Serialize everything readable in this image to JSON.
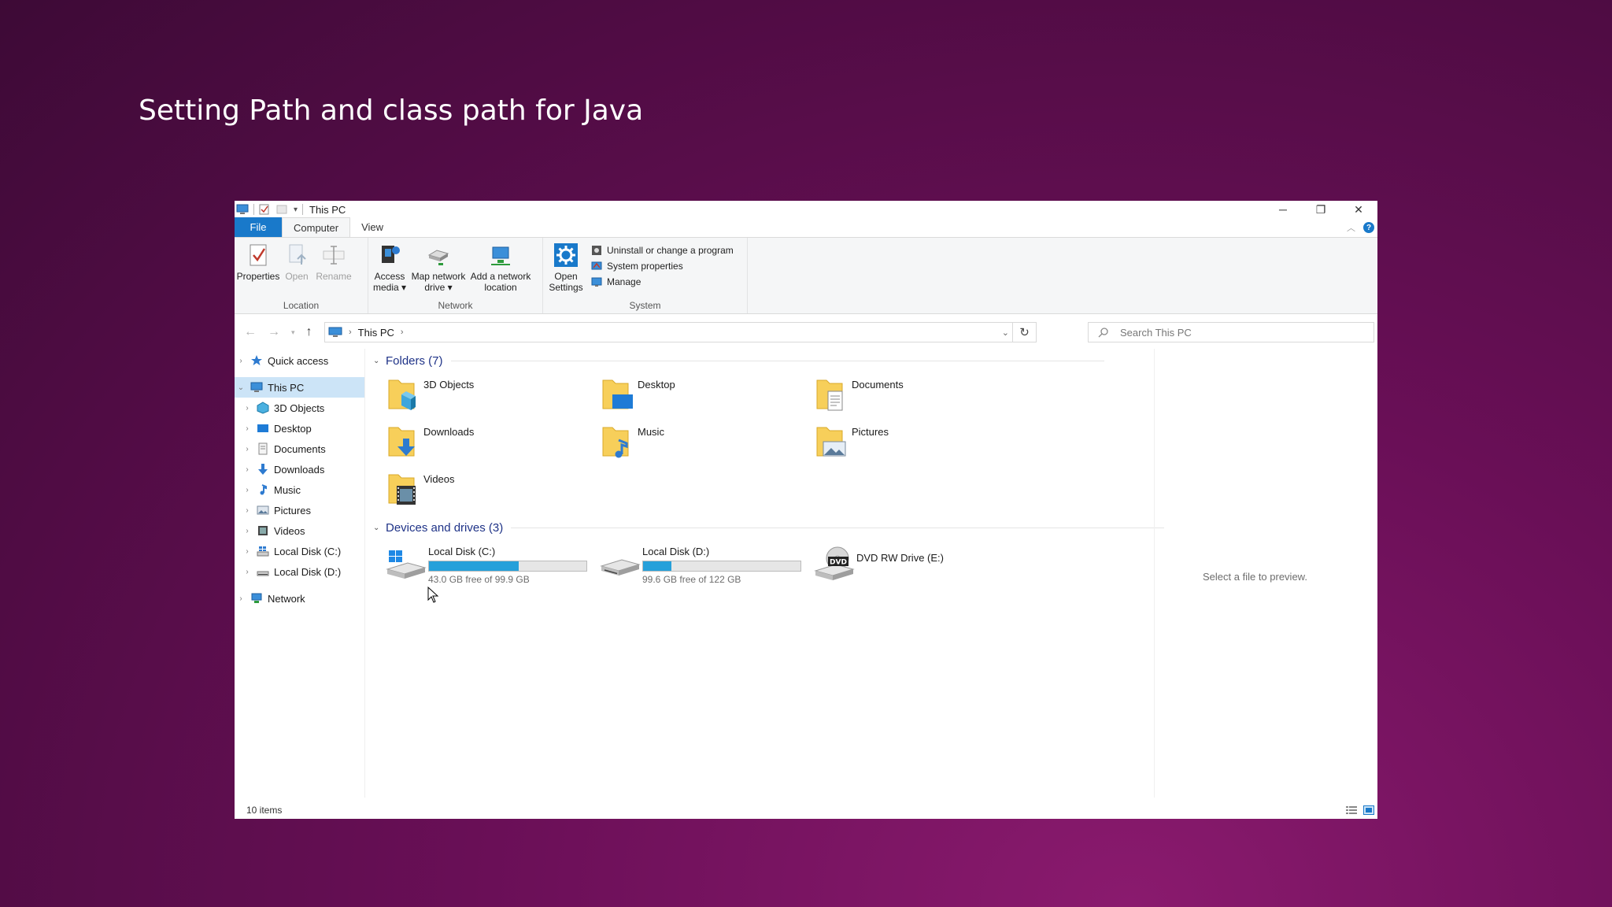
{
  "slide": {
    "title": "Setting Path and class path for Java"
  },
  "window": {
    "title": "This PC",
    "controls": {
      "minimize": "─",
      "restore": "❐",
      "close": "✕"
    }
  },
  "tabs": [
    {
      "label": "File"
    },
    {
      "label": "Computer"
    },
    {
      "label": "View"
    }
  ],
  "ribbon": {
    "location": {
      "label": "Location",
      "properties": "Properties",
      "open": "Open",
      "rename": "Rename"
    },
    "network": {
      "label": "Network",
      "access_media_1": "Access",
      "access_media_2": "media ▾",
      "map_drive_1": "Map network",
      "map_drive_2": "drive ▾",
      "add_location_1": "Add a network",
      "add_location_2": "location"
    },
    "system": {
      "label": "System",
      "open_settings_1": "Open",
      "open_settings_2": "Settings",
      "uninstall": "Uninstall or change a program",
      "system_properties": "System properties",
      "manage": "Manage"
    }
  },
  "address": {
    "crumb": "This PC",
    "search_placeholder": "Search This PC"
  },
  "nav": {
    "quick_access": "Quick access",
    "this_pc": "This PC",
    "children": [
      "3D Objects",
      "Desktop",
      "Documents",
      "Downloads",
      "Music",
      "Pictures",
      "Videos",
      "Local Disk (C:)",
      "Local Disk (D:)"
    ],
    "network": "Network"
  },
  "folders": {
    "heading": "Folders (7)",
    "items": [
      "3D Objects",
      "Desktop",
      "Documents",
      "Downloads",
      "Music",
      "Pictures",
      "Videos"
    ]
  },
  "drives": {
    "heading": "Devices and drives (3)",
    "items": [
      {
        "name": "Local Disk (C:)",
        "free": "43.0 GB free of 99.9 GB",
        "used_fraction": 0.57
      },
      {
        "name": "Local Disk (D:)",
        "free": "99.6 GB free of 122 GB",
        "used_fraction": 0.18
      },
      {
        "name": "DVD RW Drive (E:)"
      }
    ]
  },
  "preview_text": "Select a file to preview.",
  "status": {
    "items": "10 items"
  },
  "colors": {
    "accent": "#1979ca",
    "bar_fill": "#26a0da",
    "group_heading": "#1e3287"
  }
}
